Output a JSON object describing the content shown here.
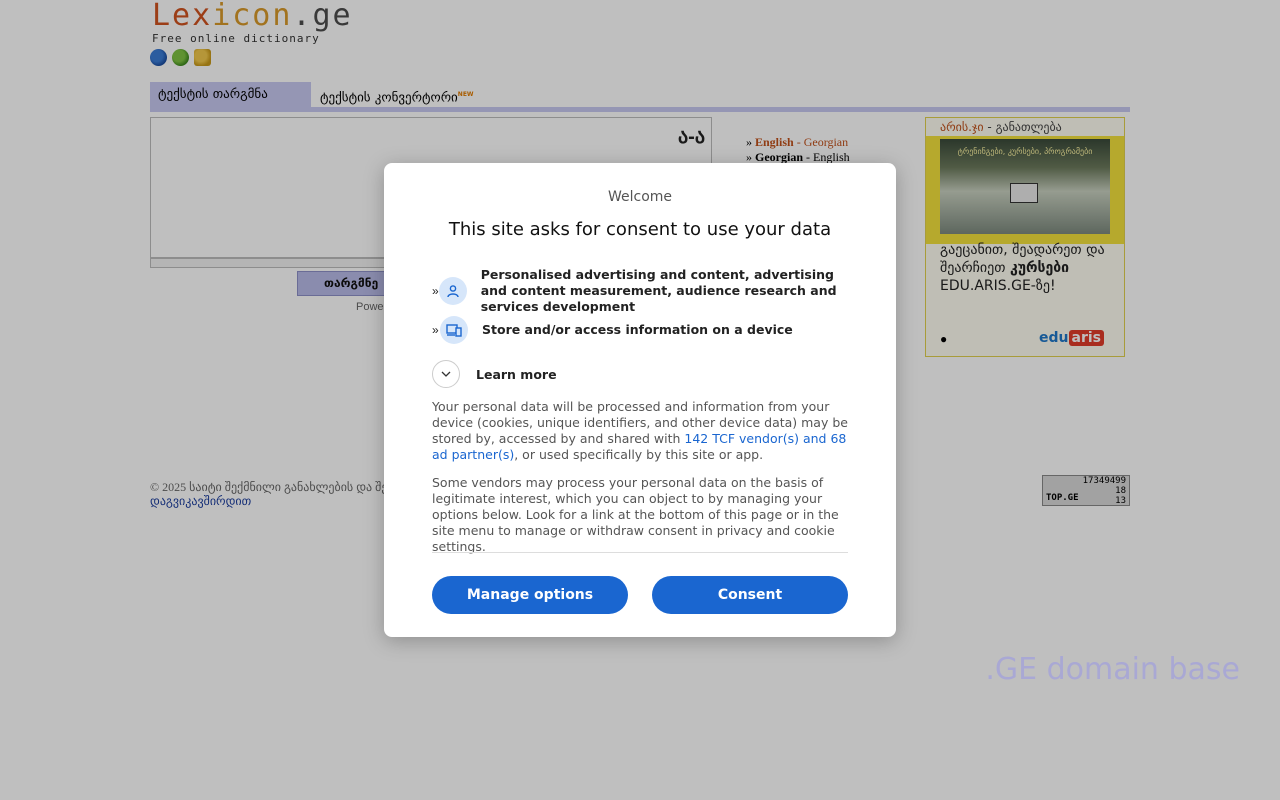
{
  "logo": {
    "title_part1": "Lex",
    "title_part2": "icon",
    "title_part3": ".ge",
    "subtitle": "Free online dictionary"
  },
  "flags": [
    "globe-icon",
    "leaf-globe-icon",
    "book-icon"
  ],
  "tabs": [
    {
      "label": "ტექსტის თარგმნა",
      "active": true
    },
    {
      "label": "ტექსტის კონვერტორი",
      "badge": "NEW",
      "active": false
    }
  ],
  "translator": {
    "translit_icon": "ა-ა",
    "translate_button": "თარგმნე",
    "powered": "Powe"
  },
  "directions": [
    {
      "from": "English",
      "to": "Georgian"
    },
    {
      "from": "Georgian",
      "to": "English"
    }
  ],
  "ad": {
    "header_brand": "არის.ჯი",
    "header_rest": " - განათლება",
    "image_text": "ტრენინგები, კურსები, პროგრამები",
    "body_part1": "გაეცანით, შეადარეთ და შეარჩიეთ ",
    "body_bold": "კურსები",
    "body_part2": " EDU.ARIS.GE-ზე!",
    "dot": "●",
    "logo_edu": "edu",
    "logo_aris": "aris"
  },
  "footer": {
    "copyright": "© 2025 საიტი შექმნილი განახლების და შემონმ",
    "contact": "დაგვიკავშირდით"
  },
  "counter": {
    "total": "17349499",
    "today": "18",
    "online": "13",
    "brand": "TOP.GE"
  },
  "watermark": ".GE domain base",
  "consent": {
    "welcome": "Welcome",
    "title": "This site asks for consent to use your data",
    "purposes": [
      {
        "icon": "person-icon",
        "text": "Personalised advertising and content, advertising and content measurement, audience research and services development"
      },
      {
        "icon": "device-icon",
        "text": "Store and/or access information on a device"
      }
    ],
    "learn_more": "Learn more",
    "para1_a": "Your personal data will be processed and information from your device (cookies, unique identifiers, and other device data) may be stored by, accessed by and shared with ",
    "para1_link": "142 TCF vendor(s) and 68 ad partner(s)",
    "para1_b": ", or used specifically by this site or app.",
    "para2": "Some vendors may process your personal data on the basis of legitimate interest, which you can object to by managing your options below. Look for a link at the bottom of this page or in the site menu to manage or withdraw consent in privacy and cookie settings.",
    "manage_button": "Manage options",
    "consent_button": "Consent"
  },
  "colors": {
    "accent_blue": "#1a66d0",
    "tab_bg": "#c7c9f0",
    "logo_orange": "#d0531f"
  }
}
